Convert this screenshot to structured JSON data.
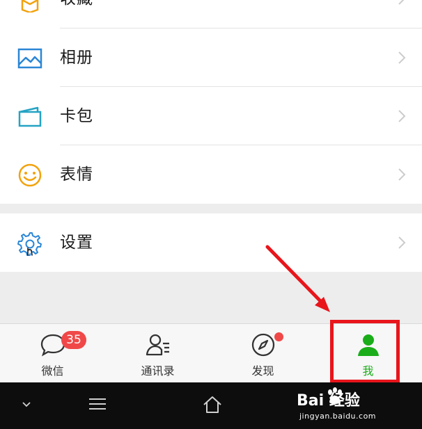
{
  "menu": {
    "items": [
      {
        "label": "收藏",
        "icon": "favorites-cube-icon"
      },
      {
        "label": "相册",
        "icon": "album-picture-icon"
      },
      {
        "label": "卡包",
        "icon": "card-wallet-icon"
      },
      {
        "label": "表情",
        "icon": "smiley-face-icon"
      }
    ],
    "settings": {
      "label": "设置",
      "icon": "gear-icon"
    }
  },
  "tabs": [
    {
      "label": "微信",
      "icon": "chat-bubble-icon",
      "badge": "35"
    },
    {
      "label": "通讯录",
      "icon": "contacts-icon"
    },
    {
      "label": "发现",
      "icon": "compass-icon",
      "dot": true
    },
    {
      "label": "我",
      "icon": "person-icon",
      "active": true
    }
  ],
  "watermark": {
    "main": "Bai 经验",
    "sub": "jingyan.baidu.com"
  },
  "colors": {
    "accent_green": "#1aad19",
    "badge_red": "#f04848",
    "annotation_red": "#e8151b",
    "background_gray": "#ededed"
  }
}
